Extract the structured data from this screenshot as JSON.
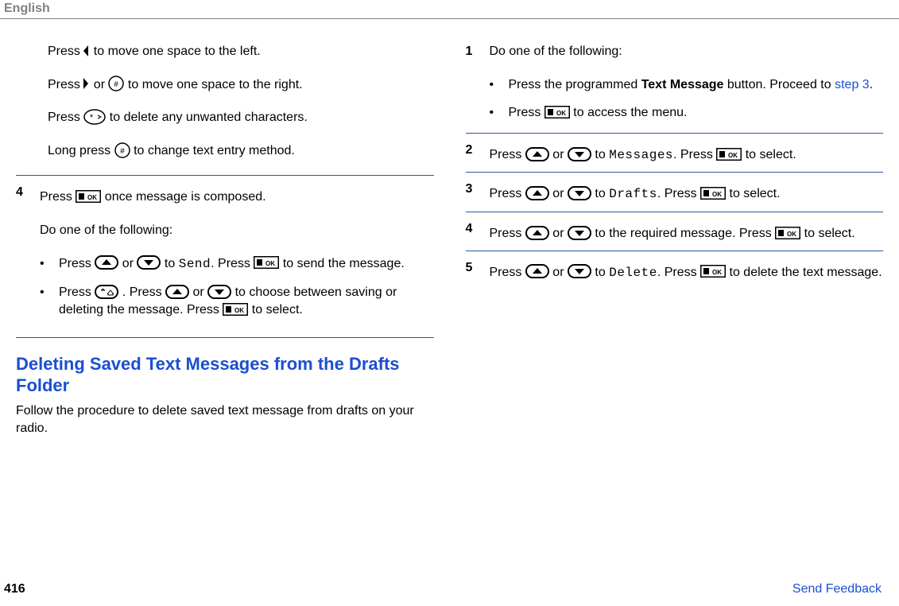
{
  "header": {
    "language": "English"
  },
  "left": {
    "l1a": "Press ",
    "l1b": " to move one space to the left.",
    "l2a": "Press ",
    "l2b": " or ",
    "l2c": " to move one space to the right.",
    "l3a": "Press ",
    "l3b": " to delete any unwanted characters.",
    "l4a": "Long press ",
    "l4b": " to change text entry method.",
    "step4_num": "4",
    "s4a": "Press ",
    "s4b": " once message is composed.",
    "s4c": "Do one of the following:",
    "s4b1a": "Press ",
    "s4b1b": " or ",
    "s4b1c": " to ",
    "s4b1_send": "Send",
    "s4b1d": ". Press ",
    "s4b1e": " to send the message.",
    "s4b2a": "Press ",
    "s4b2b": " . Press ",
    "s4b2c": " or ",
    "s4b2d": " to choose between saving or deleting the message. Press ",
    "s4b2e": " to select.",
    "h2": "Deleting Saved Text Messages from the Drafts Folder",
    "h2desc": "Follow the procedure to delete saved text message from drafts on your radio."
  },
  "right": {
    "r1_num": "1",
    "r1a": "Do one of the following:",
    "r1b1a": "Press the programmed ",
    "r1b1_bold": "Text Message",
    "r1b1b": " button. Proceed to ",
    "r1b1_link": "step 3",
    "r1b1c": ".",
    "r1b2a": "Press ",
    "r1b2b": " to access the menu.",
    "r2_num": "2",
    "r2a": "Press ",
    "r2b": " or ",
    "r2c": " to ",
    "r2_msg": "Messages",
    "r2d": ". Press ",
    "r2e": " to select.",
    "r3_num": "3",
    "r3a": "Press ",
    "r3b": " or ",
    "r3c": " to ",
    "r3_drafts": "Drafts",
    "r3d": ". Press ",
    "r3e": " to select.",
    "r4_num": "4",
    "r4a": "Press ",
    "r4b": " or ",
    "r4c": " to the required message. Press ",
    "r4d": " to select.",
    "r5_num": "5",
    "r5a": "Press ",
    "r5b": " or ",
    "r5c": " to ",
    "r5_delete": "Delete",
    "r5d": ". Press ",
    "r5e": " to delete the text message."
  },
  "footer": {
    "page": "416",
    "feedback": "Send Feedback"
  }
}
